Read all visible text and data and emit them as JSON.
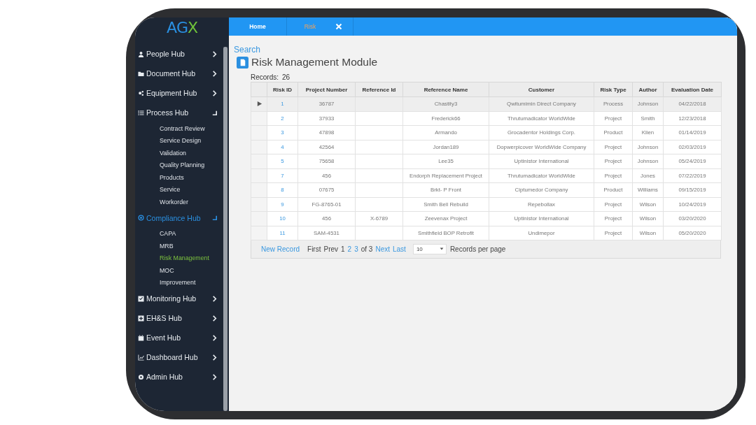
{
  "logo": "AGX",
  "tabs": [
    {
      "label": "Home",
      "selected": false,
      "closable": false
    },
    {
      "label": "Risk",
      "selected": true,
      "closable": true
    }
  ],
  "sidebar": {
    "items": [
      {
        "label": "People Hub",
        "expanded": false,
        "active": false
      },
      {
        "label": "Document Hub",
        "expanded": false,
        "active": false
      },
      {
        "label": "Equipment Hub",
        "expanded": false,
        "active": false
      },
      {
        "label": "Process Hub",
        "expanded": true,
        "active": false,
        "children": [
          {
            "label": "Contract Review",
            "selected": false
          },
          {
            "label": "Service Design",
            "selected": false
          },
          {
            "label": "Validation",
            "selected": false
          },
          {
            "label": "Quality Planning",
            "selected": false
          },
          {
            "label": "Products",
            "selected": false
          },
          {
            "label": "Service",
            "selected": false
          },
          {
            "label": "Workorder",
            "selected": false
          }
        ]
      },
      {
        "label": "Compliance Hub",
        "expanded": true,
        "active": true,
        "children": [
          {
            "label": "CAPA",
            "selected": false
          },
          {
            "label": "MRB",
            "selected": false
          },
          {
            "label": "Risk Management",
            "selected": true
          },
          {
            "label": "MOC",
            "selected": false
          },
          {
            "label": "Improvement",
            "selected": false
          }
        ]
      },
      {
        "label": "Monitoring Hub",
        "expanded": false,
        "active": false
      },
      {
        "label": "EH&S Hub",
        "expanded": false,
        "active": false
      },
      {
        "label": "Event Hub",
        "expanded": false,
        "active": false
      },
      {
        "label": "Dashboard Hub",
        "expanded": false,
        "active": false
      },
      {
        "label": "Admin Hub",
        "expanded": false,
        "active": false
      }
    ]
  },
  "search_link": "Search",
  "title": "Risk Management Module",
  "records_label": "Records:",
  "records_count": "26",
  "table": {
    "columns": [
      "Risk ID",
      "Project Number",
      "Reference Id",
      "Reference Name",
      "Customer",
      "Risk Type",
      "Author",
      "Evaluation Date"
    ],
    "rows": [
      {
        "selected": true,
        "cells": [
          "1",
          "36787",
          "",
          "Chastity3",
          "Qwitumimin Direct Company",
          "Process",
          "Johnson",
          "04/22/2018"
        ]
      },
      {
        "selected": false,
        "cells": [
          "2",
          "37933",
          "",
          "Frederick66",
          "Thrutumadicator WorldWide",
          "Project",
          "Smith",
          "12/23/2018"
        ]
      },
      {
        "selected": false,
        "cells": [
          "3",
          "47898",
          "",
          "Armando",
          "Grocadentor Holdings Corp.",
          "Product",
          "Klien",
          "01/14/2019"
        ]
      },
      {
        "selected": false,
        "cells": [
          "4",
          "42564",
          "",
          "Jordan189",
          "Dopwerpicover WorldWide Company",
          "Project",
          "Johnson",
          "02/03/2019"
        ]
      },
      {
        "selected": false,
        "cells": [
          "5",
          "75658",
          "",
          "Lee35",
          "Uptinistor International",
          "Project",
          "Johnson",
          "05/24/2019"
        ]
      },
      {
        "selected": false,
        "cells": [
          "7",
          "456",
          "",
          "Endorph Replacement Project",
          "Thrutumadicator WorldWide",
          "Project",
          "Jones",
          "07/22/2019"
        ]
      },
      {
        "selected": false,
        "cells": [
          "8",
          "07675",
          "",
          "Brkt- P Front",
          "Ciptumedor Company",
          "Product",
          "Williams",
          "09/15/2019"
        ]
      },
      {
        "selected": false,
        "cells": [
          "9",
          "FG-8765-01",
          "",
          "Smith Bell Rebuild",
          "Repebollax",
          "Project",
          "Wilson",
          "10/24/2019"
        ]
      },
      {
        "selected": false,
        "cells": [
          "10",
          "456",
          "X-6789",
          "Zeevenax Project",
          "Uptinistor International",
          "Project",
          "Wilson",
          "03/20/2020"
        ]
      },
      {
        "selected": false,
        "cells": [
          "11",
          "SAM-4531",
          "",
          "Smithfield BOP Retrofit",
          "Undimepor",
          "Project",
          "Wilson",
          "05/20/2020"
        ]
      }
    ]
  },
  "pager": {
    "new_record": "New Record",
    "items": [
      {
        "label": "First",
        "link": false
      },
      {
        "label": "Prev",
        "link": false
      },
      {
        "label": "1",
        "link": false
      },
      {
        "label": "2",
        "link": true
      },
      {
        "label": "3",
        "link": true
      },
      {
        "label": "of 3",
        "link": false
      },
      {
        "label": "Next",
        "link": true
      },
      {
        "label": "Last",
        "link": true
      }
    ],
    "page_size": "10",
    "page_size_label": "Records per page"
  }
}
